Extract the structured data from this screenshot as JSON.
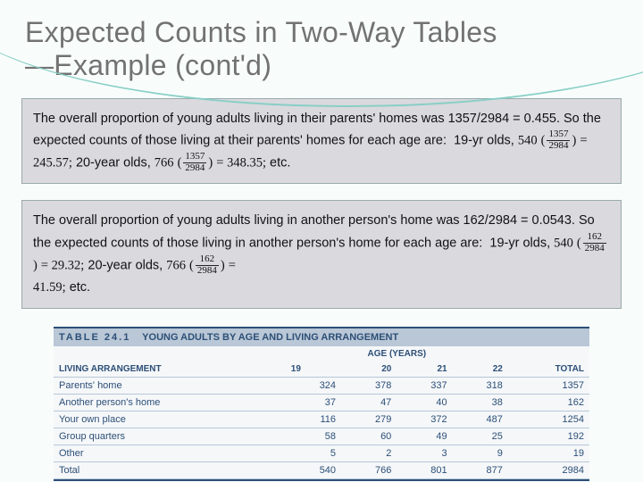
{
  "title_line1": "Expected Counts in Two-Way Tables",
  "title_line2": "—Example (cont'd)",
  "box1": {
    "intro": "The overall proportion of young adults living in their parents' homes was 1357/2984 = 0.455. So the expected counts of those living at their parents' homes for each age are:",
    "a_label": "19-yr olds,",
    "a_n": "540",
    "a_num": "1357",
    "a_den": "2984",
    "a_res": "= 245.57;",
    "b_label": "20-year olds,",
    "b_n": "766",
    "b_num": "1357",
    "b_den": "2984",
    "b_res": "= 348.35;",
    "etc": "etc."
  },
  "box2": {
    "intro": "The overall proportion of young adults living in another person's home was 162/2984 = 0.0543. So the expected counts of those living in another person's home for each age are:",
    "a_label": "19-yr olds,",
    "a_n": "540",
    "a_num": "162",
    "a_den": "2984",
    "a_res": "= 29.32;",
    "b_label": "20-year olds,",
    "b_n": "766",
    "b_num": "162",
    "b_den": "2984",
    "b_res": "=",
    "b_res2": "41.59;",
    "etc": "etc."
  },
  "table": {
    "caption_num": "TABLE 24.1",
    "caption_txt": "YOUNG ADULTS BY AGE AND LIVING ARRANGEMENT",
    "col0": "LIVING ARRANGEMENT",
    "age_hdr": "AGE (YEARS)",
    "c1": "19",
    "c2": "20",
    "c3": "21",
    "c4": "22",
    "c5": "TOTAL",
    "rows": [
      {
        "label": "Parents' home",
        "v": [
          "324",
          "378",
          "337",
          "318",
          "1357"
        ]
      },
      {
        "label": "Another person's home",
        "v": [
          "37",
          "47",
          "40",
          "38",
          "162"
        ]
      },
      {
        "label": "Your own place",
        "v": [
          "116",
          "279",
          "372",
          "487",
          "1254"
        ]
      },
      {
        "label": "Group quarters",
        "v": [
          "58",
          "60",
          "49",
          "25",
          "192"
        ]
      },
      {
        "label": "Other",
        "v": [
          "5",
          "2",
          "3",
          "9",
          "19"
        ]
      },
      {
        "label": "Total",
        "v": [
          "540",
          "766",
          "801",
          "877",
          "2984"
        ]
      }
    ]
  },
  "chart_data": {
    "type": "table",
    "title": "Young adults by age and living arrangement",
    "columns": [
      "Living arrangement",
      "19",
      "20",
      "21",
      "22",
      "Total"
    ],
    "rows": [
      [
        "Parents' home",
        324,
        378,
        337,
        318,
        1357
      ],
      [
        "Another person's home",
        37,
        47,
        40,
        38,
        162
      ],
      [
        "Your own place",
        116,
        279,
        372,
        487,
        1254
      ],
      [
        "Group quarters",
        58,
        60,
        49,
        25,
        192
      ],
      [
        "Other",
        5,
        2,
        3,
        9,
        19
      ],
      [
        "Total",
        540,
        766,
        801,
        877,
        2984
      ]
    ]
  }
}
